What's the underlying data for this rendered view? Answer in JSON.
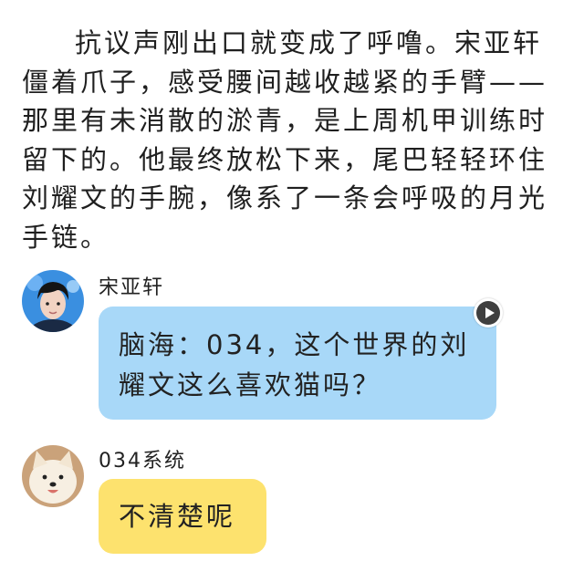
{
  "narrative": {
    "paragraph": "抗议声刚出口就变成了呼噜。宋亚轩僵着爪子，感受腰间越收越紧的手臂——那里有未消散的淤青，是上周机甲训练时留下的。他最终放松下来，尾巴轻轻环住刘耀文的手腕，像系了一条会呼吸的月光手链。"
  },
  "messages": [
    {
      "sender": "宋亚轩",
      "avatar_icon": "person-avatar-icon",
      "text": "脑海：034，这个世界的刘耀文这么喜欢猫吗？",
      "bubble_color": "#a8d8f8",
      "play_icon": "play-icon"
    },
    {
      "sender": "034系统",
      "avatar_icon": "dog-avatar-icon",
      "text": "不清楚呢",
      "bubble_color": "#fde26e"
    }
  ]
}
